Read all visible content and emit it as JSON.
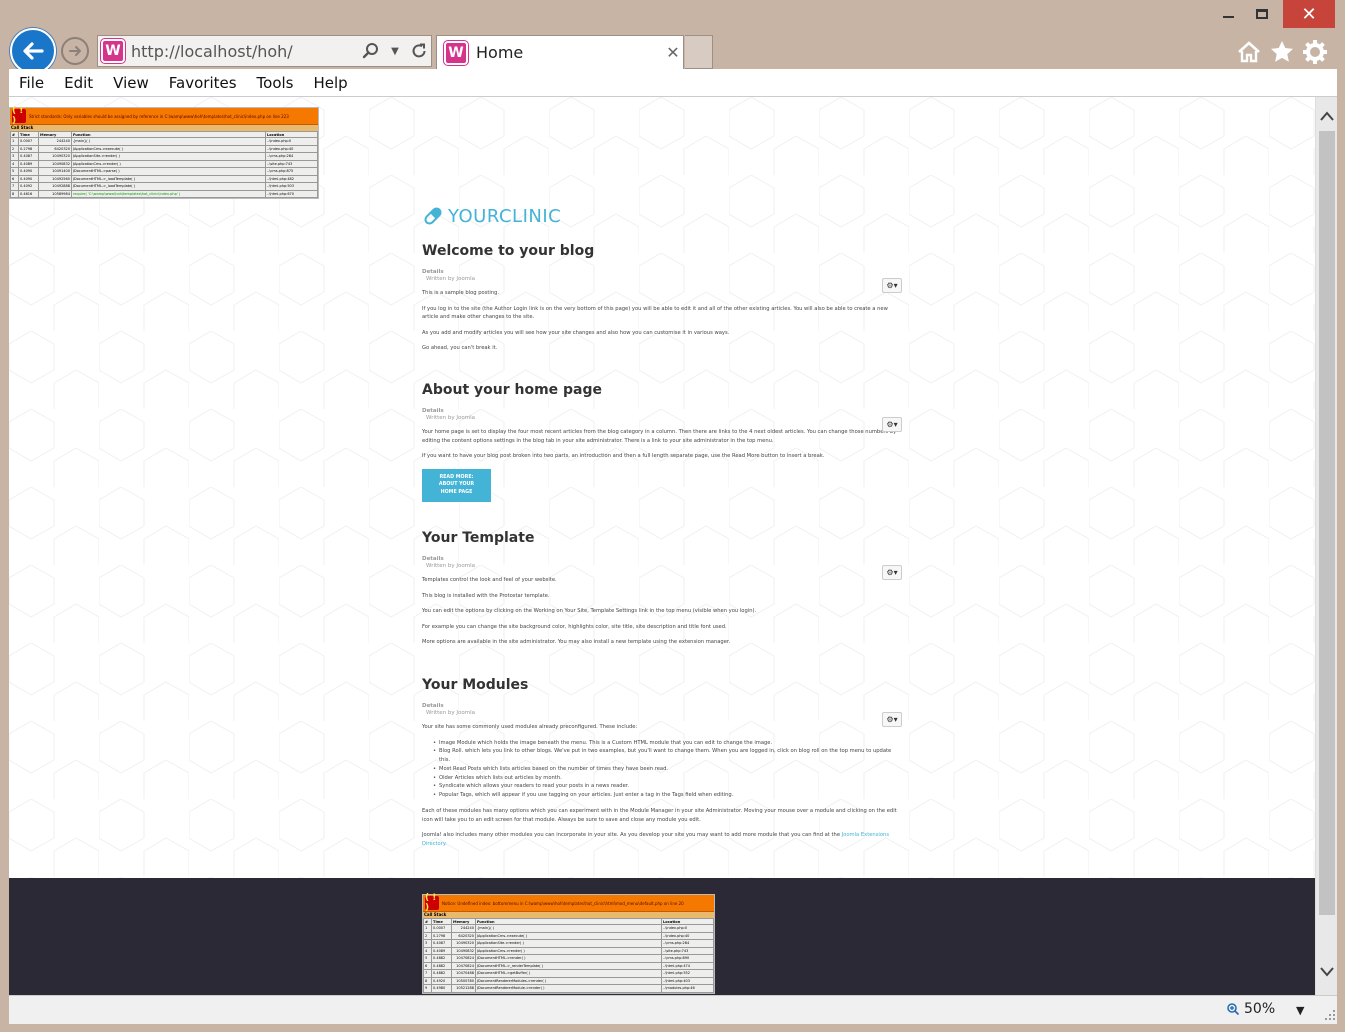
{
  "browser": {
    "url": "http://localhost/hoh/",
    "tab_title": "Home",
    "menu": [
      "File",
      "Edit",
      "View",
      "Favorites",
      "Tools",
      "Help"
    ],
    "zoom": "50%",
    "favicon_letter": "W"
  },
  "php_error_top": {
    "message": "Strict standards: Only variables should be assigned by reference in C:\\wamp\\www\\hoh\\templates\\hot_clinic\\index.php on line 223",
    "callstack_label": "Call Stack",
    "columns": [
      "#",
      "Time",
      "Memory",
      "Function",
      "Location"
    ],
    "rows": [
      [
        "1",
        "0.0007",
        "244240",
        "{main}( )",
        "..\\index.php:0"
      ],
      [
        "2",
        "0.2798",
        "6420320",
        "JApplicationCms->execute( )",
        "..\\index.php:40"
      ],
      [
        "3",
        "0.4087",
        "10490320",
        "JApplicationSite->render( )",
        "..\\cms.php:284"
      ],
      [
        "4",
        "0.4089",
        "10490832",
        "JApplicationCms->render( )",
        "..\\site.php:743"
      ],
      [
        "5",
        "0.4090",
        "10491400",
        "JDocumentHTML->parse( )",
        "..\\cms.php:875"
      ],
      [
        "6",
        "0.4090",
        "10492560",
        "JDocumentHTML->_loadTemplate( )",
        "..\\html.php:482"
      ],
      [
        "7",
        "0.4092",
        "10492888",
        "JDocumentHTML->_loadTemplate( )",
        "..\\html.php:503"
      ],
      [
        "8",
        "0.4616",
        "10589984",
        "require( 'C:\\wamp\\www\\hoh\\templates\\hot_clinic\\index.php' )",
        "..\\html.php:670"
      ]
    ]
  },
  "php_error_bottom": {
    "message": "Notice: Undefined index: bottommenu in C:\\wamp\\www\\hoh\\templates\\hot_clinic\\html\\mod_menu\\default.php on line 20",
    "callstack_label": "Call Stack",
    "columns": [
      "#",
      "Time",
      "Memory",
      "Function",
      "Location"
    ],
    "rows": [
      [
        "1",
        "0.0007",
        "244240",
        "{main}( )",
        "..\\index.php:0"
      ],
      [
        "2",
        "0.2798",
        "6420320",
        "JApplicationCms->execute( )",
        "..\\index.php:40"
      ],
      [
        "3",
        "0.4087",
        "10490320",
        "JApplicationSite->render( )",
        "..\\cms.php:284"
      ],
      [
        "4",
        "0.4089",
        "10490832",
        "JApplicationCms->render( )",
        "..\\site.php:743"
      ],
      [
        "5",
        "0.4882",
        "10470824",
        "JDocumentHTML->render( )",
        "..\\cms.php:890"
      ],
      [
        "6",
        "0.4882",
        "10470824",
        "JDocumentHTML->_renderTemplate( )",
        "..\\html.php:474"
      ],
      [
        "7",
        "0.4882",
        "10470488",
        "JDocumentHTML->getBuffer( )",
        "..\\html.php:552"
      ],
      [
        "8",
        "0.4920",
        "10500780",
        "JDocumentRendererModules->render( )",
        "..\\html.php:403"
      ],
      [
        "9",
        "0.4980",
        "10521288",
        "JDocumentRendererModule->render( )",
        "..\\modules.php:46"
      ]
    ]
  },
  "site": {
    "logo_part1": "Your",
    "logo_part2": "Clinic"
  },
  "articles": [
    {
      "title": "Welcome to your blog",
      "details": "Details",
      "author": "Written by Joomla",
      "paragraphs": [
        "This is a sample blog posting.",
        "If you log in to the site (the Author Login link is on the very bottom of this page) you will be able to edit it and all of the other existing articles. You will also be able to create a new article and make other changes to the site.",
        "As you add and modify articles you will see how your site changes and also how you can customise it in various ways.",
        "Go ahead, you can't break it."
      ]
    },
    {
      "title": "About your home page",
      "details": "Details",
      "author": "Written by Joomla",
      "paragraphs": [
        "Your home page is set to display the four most recent articles from the blog category in a column. Then there are links to the 4 next oldest articles. You can change those numbers by editing the content options settings in the blog tab in your site administrator. There is a link to your site administrator in the top menu.",
        "If you want to have your blog post broken into two parts, an introduction and then a full length separate page, use the Read More button to insert a break."
      ],
      "readmore": "READ MORE: ABOUT YOUR HOME PAGE"
    },
    {
      "title": "Your Template",
      "details": "Details",
      "author": "Written by Joomla",
      "paragraphs": [
        "Templates control the look and feel of your website.",
        "This blog is installed with the Protostar template.",
        "You can edit the options by clicking on the Working on Your Site, Template Settings link in the top menu (visible when you login).",
        "For example you can change the site background color, highlights color, site title, site description and title font used.",
        "More options are available in the site administrator. You may also install a new template using the extension manager."
      ]
    },
    {
      "title": "Your Modules",
      "details": "Details",
      "author": "Written by Joomla",
      "intro": "Your site has some commonly used modules already preconfigured. These include:",
      "list": [
        "Image Module which holds the image beneath the menu. This is a Custom HTML module that you can edit to change the image.",
        "Blog Roll. which lets you link to other blogs. We've put in two examples, but you'll want to change them. When you are logged in, click on blog roll on the top menu to update this.",
        "Most Read Posts which lists articles based on the number of times they have been read.",
        "Older Articles which lists out articles by month.",
        "Syndicate which allows your readers to read your posts in a news reader.",
        "Popular Tags, which will appear if you use tagging on your articles. Just enter a tag in the Tags field when editing."
      ],
      "outro": "Each of these modules has many options which you can experiment with in the Module Manager in your site Administrator. Moving your mouse over a module and clicking on the edit icon will take you to an edit screen for that module. Always be sure to save and close any module you edit.",
      "final_text": "Joomla! also includes many other modules you can incorporate in your site. As you develop your site you may want to add more module that you can find at the ",
      "final_link": "Joomla Extensions Directory."
    }
  ],
  "colors": {
    "accent": "#43b3d6",
    "footer": "#2a2935",
    "error_header": "#f57900",
    "back_button": "#1a76c9"
  }
}
